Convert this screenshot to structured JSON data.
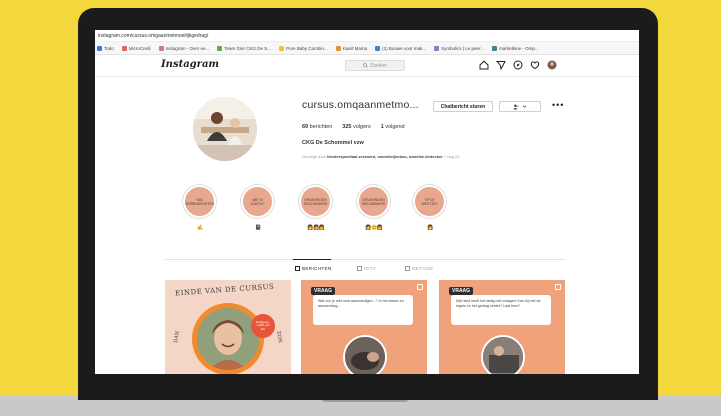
{
  "browser": {
    "url": "instagram.com/cursus.omgaanmetmoeilijkgedrag/",
    "bookmarks": [
      {
        "label": "Todo",
        "color": "#3c78d8"
      },
      {
        "label": "MicroCredi",
        "color": "#e06666"
      },
      {
        "label": "Instagram - Over ee...",
        "color": "#c27ba0"
      },
      {
        "label": "Team Gier CKG De S...",
        "color": "#6aa84f"
      },
      {
        "label": "Pure Baby Combin...",
        "color": "#f1c232"
      },
      {
        "label": "Kaart Mama",
        "color": "#e69138"
      },
      {
        "label": "(1) Bouwe voor mak...",
        "color": "#3d85c6"
      },
      {
        "label": "Symbolics | Le peer...",
        "color": "#8e7cc3"
      },
      {
        "label": "marketkine - Omp...",
        "color": "#45818e"
      }
    ]
  },
  "header": {
    "logo": "Instagram",
    "search_placeholder": "Zoeken"
  },
  "profile": {
    "username": "cursus.omqaanmetmo...",
    "message_button": "Chatbericht sturen",
    "more": "•••",
    "posts": "69",
    "posts_label": "berichten",
    "followers": "325",
    "followers_label": "volgers",
    "following": "1",
    "following_label": "volgend",
    "full_name": "CKG De Schommel vzw",
    "followed_by_prefix": "Gevolgd door",
    "followed_by_names": "kleuterspeeltaal.zeeuwen, ommeletjenbos, mareike.dedecker",
    "followed_by_suffix": "+ nog 24"
  },
  "highlights": [
    {
      "label": "Van verbindensten",
      "emoji": "✍"
    },
    {
      "label": "Wie is Judith?",
      "emoji": "📓"
    },
    {
      "label": "Ervaringen deelnemers",
      "emoji": "👩👩👩"
    },
    {
      "label": "Ervaringen deelnemers",
      "emoji": "👩😊👩"
    },
    {
      "label": "Tip je weetjes",
      "emoji": "👩"
    }
  ],
  "tabs": [
    {
      "label": "BERICHTEN",
      "active": true
    },
    {
      "label": "IGTV",
      "active": false
    },
    {
      "label": "GETAGD",
      "active": false
    }
  ],
  "posts": [
    {
      "title": "EINDE VAN DE CURSUS",
      "side_left": "DAN",
      "side_right": "ZON",
      "badge": "Pedagoog - Judith van Der"
    },
    {
      "tag": "VRAAG",
      "question": "Wat zou je met oma aanmoedigen...? In het wisser en aanwenning..."
    },
    {
      "tag": "VRAAG",
      "question": "Mijn kind heeft het lastig met vraagen! Kan hij met de regels en het gedrag verder? Laat hem?"
    }
  ],
  "colors": {
    "background": "#f2d83c",
    "highlight": "#e8a78f",
    "post_orange": "#f0a37a"
  }
}
